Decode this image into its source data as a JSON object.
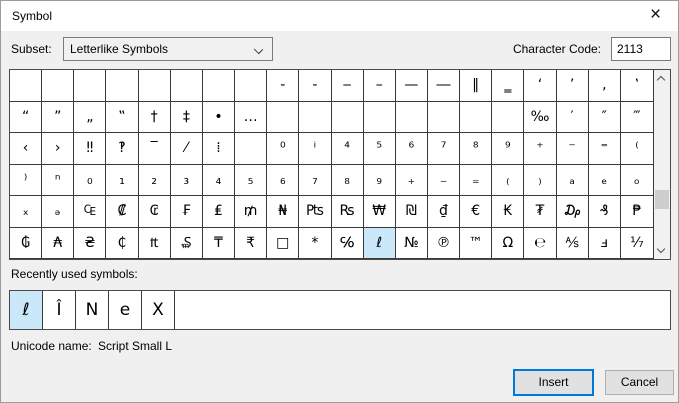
{
  "window": {
    "title": "Symbol"
  },
  "icons": {
    "close": "×",
    "combo_chevron": "chevron-down",
    "scroll_up": "chevron-up",
    "scroll_down": "chevron-down"
  },
  "controls": {
    "subset_label": "Subset:",
    "subset_value": "Letterlike Symbols",
    "char_code_label": "Character Code:",
    "char_code_value": "2113"
  },
  "grid": {
    "columns": 20,
    "visible_rows": 6,
    "selected": {
      "row": 5,
      "col": 11,
      "char": "ℓ"
    },
    "rows": [
      [
        "",
        "",
        "",
        "",
        "",
        "",
        "",
        "",
        "‐",
        "‑",
        "‒",
        "–",
        "—",
        "―",
        "‖",
        "‗",
        "‘",
        "’",
        "‚",
        "‛"
      ],
      [
        "“",
        "”",
        "„",
        "‟",
        "†",
        "‡",
        "•",
        "…",
        "",
        "",
        "",
        "",
        "",
        "",
        "",
        "",
        "‰",
        "′",
        "″",
        "‴"
      ],
      [
        "‹",
        "›",
        "‼",
        "‽",
        "‾",
        "⁄",
        "⁞",
        "",
        "⁰",
        "ⁱ",
        "⁴",
        "⁵",
        "⁶",
        "⁷",
        "⁸",
        "⁹",
        "⁺",
        "⁻",
        "⁼",
        "⁽"
      ],
      [
        "⁾",
        "ⁿ",
        "₀",
        "₁",
        "₂",
        "₃",
        "₄",
        "₅",
        "₆",
        "₇",
        "₈",
        "₉",
        "₊",
        "₋",
        "₌",
        "₍",
        "₎",
        "ₐ",
        "ₑ",
        "ₒ"
      ],
      [
        "ₓ",
        "ₔ",
        "₠",
        "₡",
        "₢",
        "₣",
        "₤",
        "₥",
        "₦",
        "₧",
        "₨",
        "₩",
        "₪",
        "₫",
        "€",
        "₭",
        "₮",
        "₯",
        "₰",
        "₱"
      ],
      [
        "₲",
        "₳",
        "₴",
        "₵",
        "₶",
        "₷",
        "₸",
        "₹",
        "□",
        "*",
        "℅",
        "ℓ",
        "№",
        "℗",
        "™",
        "Ω",
        "℮",
        "⅍",
        "ⅎ",
        "⅐"
      ]
    ]
  },
  "recent": {
    "label": "Recently used symbols:",
    "symbols": [
      "ℓ",
      "Î",
      "N",
      "e",
      "X"
    ],
    "selected_index": 0
  },
  "footer": {
    "unicode_name_label": "Unicode name:",
    "unicode_name_value": "Script Small L"
  },
  "buttons": {
    "insert": "Insert",
    "cancel": "Cancel"
  },
  "colors": {
    "selection": "#cbe8fa",
    "default_button_border": "#0078d7",
    "dialog_bg": "#f0f0f0",
    "scroll_thumb": "#cdcdcd"
  }
}
